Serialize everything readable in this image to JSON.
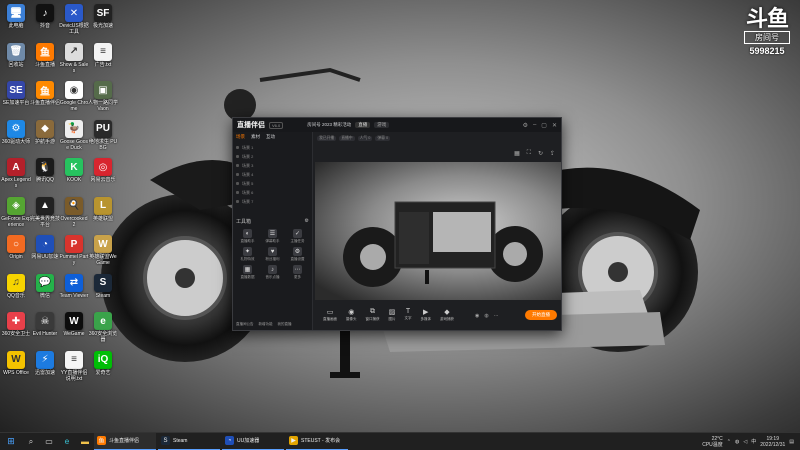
{
  "desktop": {
    "icons": [
      {
        "label": "此电脑",
        "icon": "computer-icon",
        "color": "#3b7fd6",
        "glyph": "🖥"
      },
      {
        "label": "抖音",
        "icon": "tiktok-icon",
        "color": "#111111",
        "glyph": "♪"
      },
      {
        "label": "DevicUS根据工具",
        "icon": "tool-x-icon",
        "color": "#2a59c9",
        "glyph": "✕"
      },
      {
        "label": "极光加速",
        "icon": "sf-icon",
        "color": "#222222",
        "glyph": "SF"
      },
      {
        "label": "回收站",
        "icon": "recycle-bin-icon",
        "color": "#6f8aa8",
        "glyph": "🗑"
      },
      {
        "label": "斗鱼直播",
        "icon": "douyu-icon",
        "color": "#ff7a00",
        "glyph": "鱼"
      },
      {
        "label": "Show & Sales",
        "icon": "shortcut-icon",
        "color": "#dddddd",
        "glyph": "↗"
      },
      {
        "label": "广告.txt",
        "icon": "text-file-icon",
        "color": "#f3f3f3",
        "glyph": "≡"
      },
      {
        "label": "SE加速平台",
        "icon": "se-icon",
        "color": "#3446a8",
        "glyph": "SE"
      },
      {
        "label": "斗鱼直播伴侣",
        "icon": "douyu-companion-icon",
        "color": "#ff8a00",
        "glyph": "鱼"
      },
      {
        "label": "Google Chrome",
        "icon": "chrome-icon",
        "color": "#ffffff",
        "glyph": "◉"
      },
      {
        "label": "人物一路同学 Vaon",
        "icon": "game-icon",
        "color": "#556b4a",
        "glyph": "▣"
      },
      {
        "label": "360驱动大师",
        "icon": "driver-icon",
        "color": "#1e88e5",
        "glyph": "⚙"
      },
      {
        "label": "护航手游",
        "icon": "shield-game-icon",
        "color": "#8a6a3b",
        "glyph": "◆"
      },
      {
        "label": "Goose Goose Duck",
        "icon": "goose-icon",
        "color": "#eeeeee",
        "glyph": "🦆"
      },
      {
        "label": "绝地求生 PUBG",
        "icon": "pubg-icon",
        "color": "#2a2a2a",
        "glyph": "PU"
      },
      {
        "label": "Apex Legends",
        "icon": "apex-icon",
        "color": "#b3202a",
        "glyph": "A"
      },
      {
        "label": "腾讯QQ",
        "icon": "qq-icon",
        "color": "#1b1b1b",
        "glyph": "🐧"
      },
      {
        "label": "KOOK",
        "icon": "kook-icon",
        "color": "#27c25f",
        "glyph": "K"
      },
      {
        "label": "网易云音乐",
        "icon": "netease-music-icon",
        "color": "#d8252f",
        "glyph": "◎"
      },
      {
        "label": "GeForce Experience",
        "icon": "geforce-icon",
        "color": "#55a532",
        "glyph": "◈"
      },
      {
        "label": "完美世界竞技平台",
        "icon": "perfect-world-icon",
        "color": "#222222",
        "glyph": "▲"
      },
      {
        "label": "Overcooked 2",
        "icon": "overcooked-icon",
        "color": "#7a5b2a",
        "glyph": "🍳"
      },
      {
        "label": "英雄联盟",
        "icon": "lol-icon",
        "color": "#b8942f",
        "glyph": "L"
      },
      {
        "label": "Origin",
        "icon": "origin-icon",
        "color": "#f26a21",
        "glyph": "○"
      },
      {
        "label": "网易UU加速",
        "icon": "uu-icon",
        "color": "#1f4fb8",
        "glyph": "◔"
      },
      {
        "label": "Pummel Party",
        "icon": "pummel-icon",
        "color": "#d8342d",
        "glyph": "P"
      },
      {
        "label": "英雄联盟WeGame",
        "icon": "wegame-icon",
        "color": "#c9a24a",
        "glyph": "W"
      },
      {
        "label": "QQ音乐",
        "icon": "qq-music-icon",
        "color": "#f7d400",
        "glyph": "♫"
      },
      {
        "label": "微信",
        "icon": "wechat-icon",
        "color": "#24b24a",
        "glyph": "💬"
      },
      {
        "label": "Team Viewer",
        "icon": "teamviewer-icon",
        "color": "#0e5fd8",
        "glyph": "⇄"
      },
      {
        "label": "Steam",
        "icon": "steam-icon",
        "color": "#1b2838",
        "glyph": "S"
      },
      {
        "label": "360安全卫士",
        "icon": "security-icon",
        "color": "#e8404a",
        "glyph": "✚"
      },
      {
        "label": "Evil Hunter",
        "icon": "evil-hunter-icon",
        "color": "#3a3a3a",
        "glyph": "☠"
      },
      {
        "label": "WeGame",
        "icon": "wegame-app-icon",
        "color": "#0d0d0d",
        "glyph": "W"
      },
      {
        "label": "360安全浏览器",
        "icon": "browser-360-icon",
        "color": "#3aa34a",
        "glyph": "e"
      },
      {
        "label": "WPS Office",
        "icon": "wps-icon",
        "color": "#f4c200",
        "glyph": "W"
      },
      {
        "label": "迅雷加速",
        "icon": "thunder-icon",
        "color": "#1d7be0",
        "glyph": "⚡"
      },
      {
        "label": "YY直播伴侣说明.txt",
        "icon": "doc-file-icon",
        "color": "#f5f5f5",
        "glyph": "≡"
      },
      {
        "label": "爱奇艺",
        "icon": "iqiyi-icon",
        "color": "#00be06",
        "glyph": "iQ"
      }
    ]
  },
  "watermark": {
    "logo": "斗鱼",
    "sub": "房间号",
    "room": "5998215"
  },
  "app": {
    "title": "直播伴侣",
    "version": "V6.0",
    "room_title": "房间号 2023 精彩活动",
    "room_chip": "直播",
    "category_chip": "游戏",
    "side_tabs": [
      "场景",
      "素材",
      "互动"
    ],
    "scenes": [
      "场景 1",
      "场景 2",
      "场景 3",
      "场景 4",
      "场景 5",
      "场景 6",
      "场景 7"
    ],
    "tools_title": "工具箱",
    "tools": [
      {
        "label": "直播助手",
        "icon": "assist-icon",
        "glyph": "◐"
      },
      {
        "label": "弹幕助手",
        "icon": "danmaku-icon",
        "glyph": "☰"
      },
      {
        "label": "主播任务",
        "icon": "task-icon",
        "glyph": "✓"
      },
      {
        "label": "礼物特效",
        "icon": "gift-icon",
        "glyph": "✦"
      },
      {
        "label": "粉丝福利",
        "icon": "fans-icon",
        "glyph": "♥"
      },
      {
        "label": "直播设置",
        "icon": "settings-icon",
        "glyph": "⚙"
      },
      {
        "label": "直播数据",
        "icon": "data-icon",
        "glyph": "▦"
      },
      {
        "label": "音乐点播",
        "icon": "music-icon",
        "glyph": "♪"
      },
      {
        "label": "更多",
        "icon": "more-icon",
        "glyph": "⋯"
      }
    ],
    "side_bottom": [
      "直播间公告",
      "新增功能",
      "我的直播"
    ],
    "tags": [
      "我已开播",
      "直播中",
      "人气 0",
      "弹幕 0"
    ],
    "controls": [
      {
        "label": "直播画面",
        "icon": "screen-icon",
        "glyph": "▭"
      },
      {
        "label": "摄像头",
        "icon": "camera-icon",
        "glyph": "◉"
      },
      {
        "label": "窗口捕获",
        "icon": "window-icon",
        "glyph": "⧉"
      },
      {
        "label": "图片",
        "icon": "image-icon",
        "glyph": "▨"
      },
      {
        "label": "文字",
        "icon": "text-icon",
        "glyph": "T"
      },
      {
        "label": "多媒体",
        "icon": "media-icon",
        "glyph": "▶"
      },
      {
        "label": "游戏捕获",
        "icon": "game-capture-icon",
        "glyph": "◆"
      }
    ],
    "start_label": "开始直播"
  },
  "taskbar": {
    "apps": [
      {
        "label": "斗鱼直播伴侣",
        "icon": "douyu-icon",
        "color": "#ff7a00",
        "glyph": "鱼",
        "active": true
      },
      {
        "label": "Steam",
        "icon": "steam-icon",
        "color": "#1b2838",
        "glyph": "S",
        "active": false
      },
      {
        "label": "UU加速器",
        "icon": "uu-icon",
        "color": "#1f4fb8",
        "glyph": "◔",
        "active": false
      },
      {
        "label": "STEUST - 发布会",
        "icon": "presentation-icon",
        "color": "#e2a400",
        "glyph": "▶",
        "active": false
      }
    ],
    "weather": "22°C",
    "weather_sub": "CPU温度",
    "time": "19:19",
    "date": "2022/12/31"
  }
}
